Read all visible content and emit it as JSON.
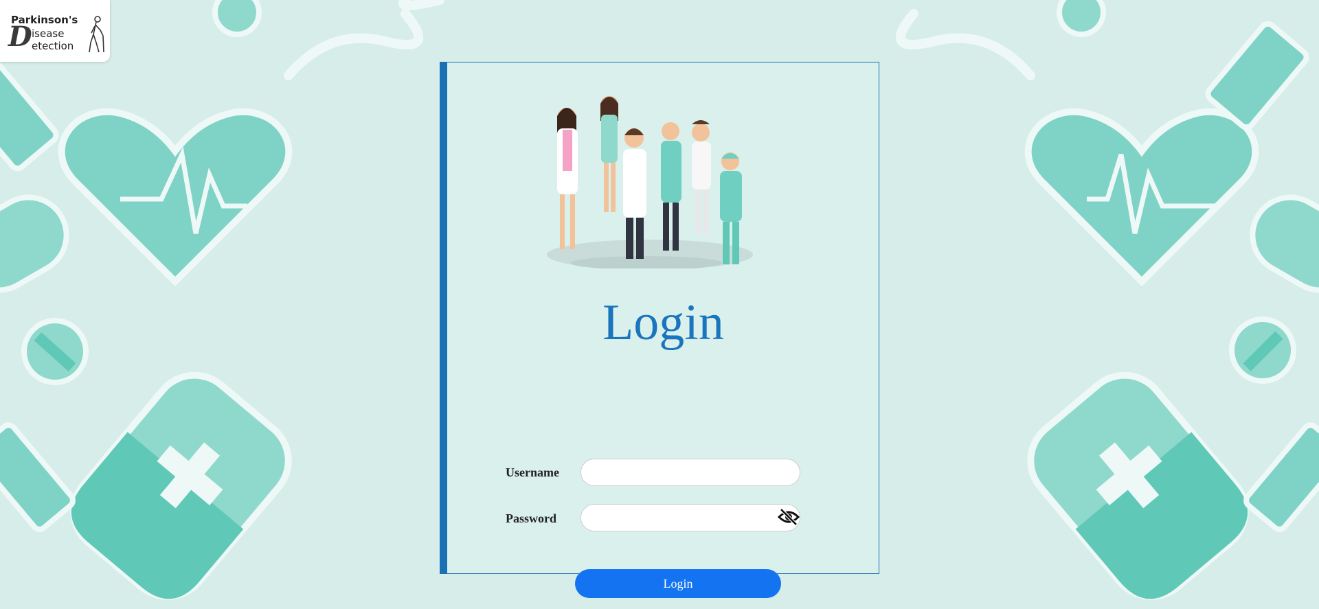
{
  "logo": {
    "line1": "Parkinson's",
    "big_letter": "D",
    "line2": "isease",
    "line3": "etection"
  },
  "login_form": {
    "title": "Login",
    "username_label": "Username",
    "username_value": "",
    "password_label": "Password",
    "password_value": "",
    "submit_label": "Login",
    "password_toggle_icon": "eye-slash-icon"
  },
  "colors": {
    "accent": "#1b75bc",
    "button": "#1473f0",
    "background": "#d6ede9",
    "illustration_teal": "#6fcfc0"
  }
}
